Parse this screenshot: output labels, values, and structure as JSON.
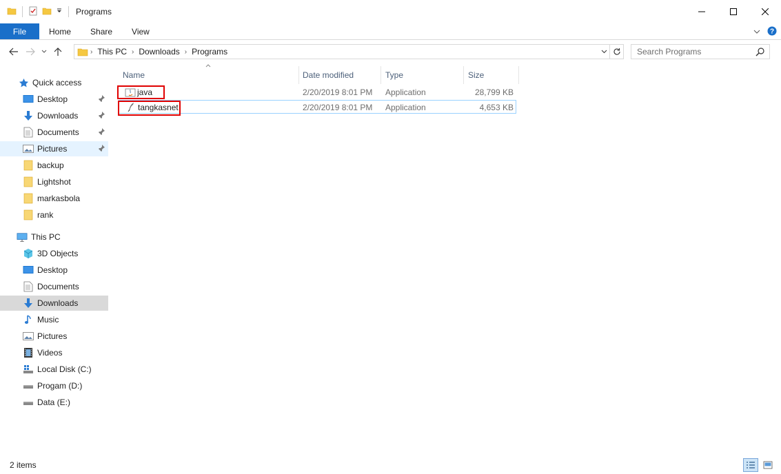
{
  "window": {
    "title": "Programs"
  },
  "ribbon": {
    "tabs": [
      "File",
      "Home",
      "Share",
      "View"
    ]
  },
  "address": {
    "crumbs": [
      "This PC",
      "Downloads",
      "Programs"
    ]
  },
  "search": {
    "placeholder": "Search Programs"
  },
  "sidebar": {
    "quick_access": {
      "label": "Quick access",
      "items": [
        "Desktop",
        "Downloads",
        "Documents",
        "Pictures",
        "backup",
        "Lightshot",
        "markasbola",
        "rank"
      ]
    },
    "this_pc": {
      "label": "This PC",
      "items": [
        "3D Objects",
        "Desktop",
        "Documents",
        "Downloads",
        "Music",
        "Pictures",
        "Videos",
        "Local Disk (C:)",
        "Progam (D:)",
        "Data (E:)"
      ]
    }
  },
  "columns": [
    "Name",
    "Date modified",
    "Type",
    "Size"
  ],
  "files": [
    {
      "name": "java",
      "date": "2/20/2019 8:01 PM",
      "type": "Application",
      "size": "28,799 KB"
    },
    {
      "name": "tangkasnet",
      "date": "2/20/2019 8:01 PM",
      "type": "Application",
      "size": "4,653 KB"
    }
  ],
  "status": {
    "count": "2 items"
  },
  "colors": {
    "accent": "#1a6fc9",
    "highlight": "#e00000",
    "selection_border": "#99d1ff",
    "folder": "#f5c842"
  }
}
